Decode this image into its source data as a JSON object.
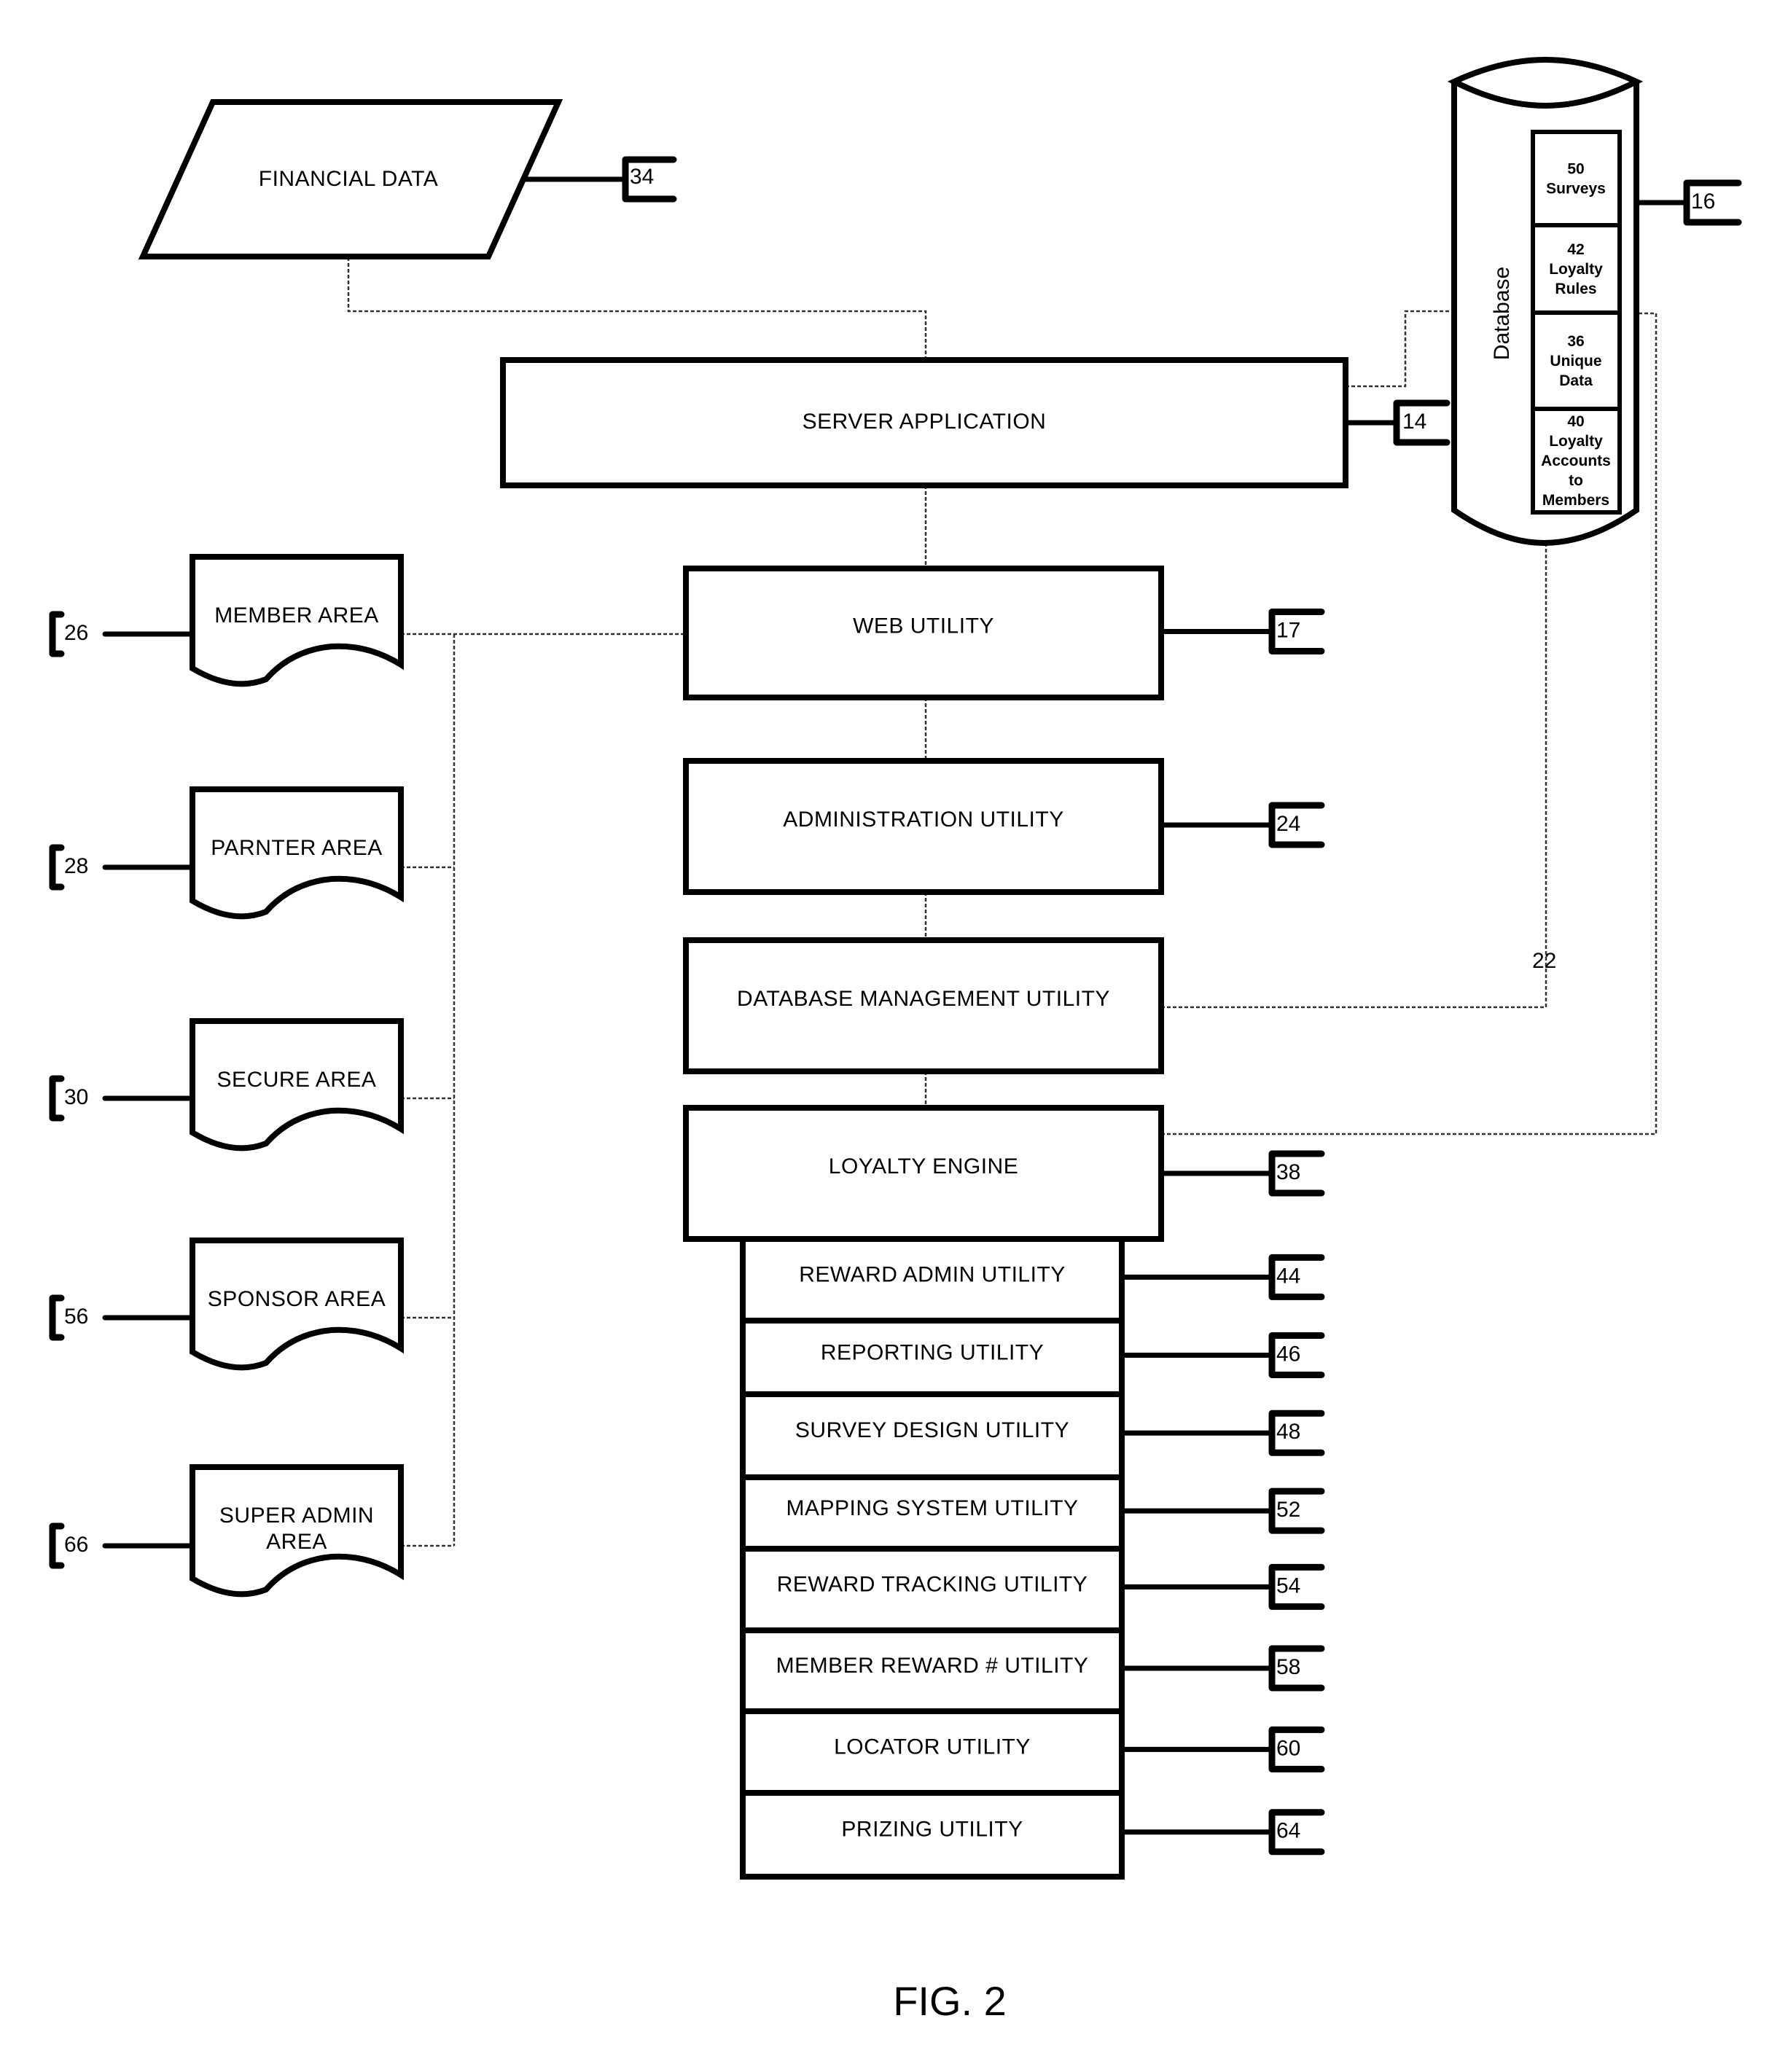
{
  "figure": {
    "caption": "FIG. 2"
  },
  "financial_data": {
    "label": "FINANCIAL DATA",
    "ref": "34"
  },
  "server_application": {
    "label": "SERVER APPLICATION",
    "ref": "14"
  },
  "database": {
    "title": "Database",
    "ref": "16",
    "link_ref": "22",
    "segments": [
      {
        "lines": [
          "50",
          "Surveys"
        ]
      },
      {
        "lines": [
          "42",
          "Loyalty",
          "Rules"
        ]
      },
      {
        "lines": [
          "36",
          "Unique",
          "Data"
        ]
      },
      {
        "lines": [
          "40",
          "Loyalty",
          "Accounts",
          "to",
          "Members"
        ]
      }
    ]
  },
  "core_modules": [
    {
      "label": "WEB UTILITY",
      "ref": "17"
    },
    {
      "label": "ADMINISTRATION UTILITY",
      "ref": "24"
    },
    {
      "label": "DATABASE MANAGEMENT UTILITY",
      "ref": ""
    },
    {
      "label": "LOYALTY ENGINE",
      "ref": "38"
    }
  ],
  "engine_utilities": [
    {
      "label": "REWARD ADMIN UTILITY",
      "ref": "44"
    },
    {
      "label": "REPORTING UTILITY",
      "ref": "46"
    },
    {
      "label": "SURVEY DESIGN UTILITY",
      "ref": "48"
    },
    {
      "label": "MAPPING SYSTEM UTILITY",
      "ref": "52"
    },
    {
      "label": "REWARD TRACKING UTILITY",
      "ref": "54"
    },
    {
      "label": "MEMBER REWARD # UTILITY",
      "ref": "58"
    },
    {
      "label": "LOCATOR UTILITY",
      "ref": "60"
    },
    {
      "label": "PRIZING UTILITY",
      "ref": "64"
    }
  ],
  "areas": [
    {
      "lines": [
        "MEMBER AREA"
      ],
      "ref": "26"
    },
    {
      "lines": [
        "PARNTER AREA"
      ],
      "ref": "28"
    },
    {
      "lines": [
        "SECURE AREA"
      ],
      "ref": "30"
    },
    {
      "lines": [
        "SPONSOR AREA"
      ],
      "ref": "56"
    },
    {
      "lines": [
        "SUPER ADMIN",
        "AREA"
      ],
      "ref": "66"
    }
  ]
}
